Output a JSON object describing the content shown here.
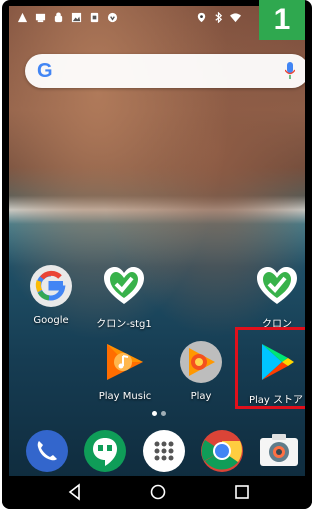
{
  "step_badge": "1",
  "search_bar": {
    "logo_letter": "G"
  },
  "apps_row1": [
    {
      "label": "Google",
      "icon": "google-icon"
    },
    {
      "label": "クロン-stg1",
      "icon": "heart-check-icon"
    },
    {
      "label": "クロン",
      "icon": "heart-check-icon"
    }
  ],
  "apps_row2": [
    {
      "label": "Play Music",
      "icon": "play-music-icon"
    },
    {
      "label": "Play",
      "icon": "play-games-icon"
    },
    {
      "label": "Play ストア",
      "icon": "play-store-icon"
    }
  ],
  "dock": [
    "phone-icon",
    "hangouts-icon",
    "app-drawer-icon",
    "chrome-icon",
    "camera-icon"
  ],
  "colors": {
    "badge": "#2fa84f",
    "highlight": "#e0101c",
    "cron_green": "#38b24a"
  }
}
